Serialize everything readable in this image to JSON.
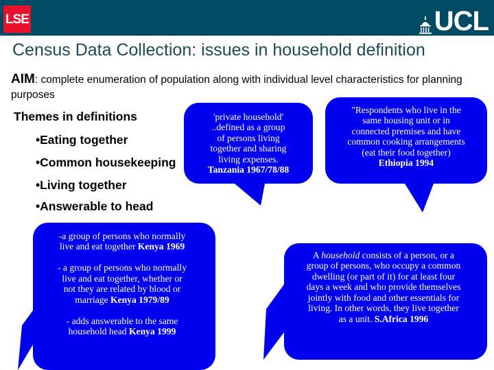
{
  "header": {
    "background_color": "#004a63",
    "lse_logo": {
      "text": "LSE",
      "background_color": "#e8112d"
    },
    "ucl_logo": {
      "text": "UCL",
      "icon": "ucl-dome-icon"
    }
  },
  "slide": {
    "title": "Census Data Collection: issues in household definition",
    "aim": {
      "label": "AIM",
      "body": ": complete enumeration of population along with individual level characteristics for planning purposes"
    },
    "themes": {
      "heading": "Themes in definitions",
      "items": [
        "•Eating together",
        "•Common housekeeping",
        "•Living together",
        "•Answerable to head"
      ]
    }
  },
  "bubbles": {
    "color": "#0000ee",
    "tanzania": {
      "name": "tanzania-definition-callout",
      "body": "'private household'\n..defined as a group\nof persons living\ntogether and sharing\nliving expenses.",
      "source": "Tanzania 1967/78/88"
    },
    "ethiopia": {
      "name": "ethiopia-definition-callout",
      "body": "\"Respondents who live in the\nsame housing unit or in\nconnected premises and have\ncommon cooking arrangements\n(eat their food together)",
      "source": "Ethiopia 1994"
    },
    "kenya": {
      "name": "kenya-definition-callout",
      "line1": "-a group of persons who normally\nlive and eat together ",
      "source1": "Kenya 1969",
      "line2": "- a group of persons who normally\nlive and eat together, whether or\nnot they are related by blood or\nmarriage ",
      "source2": "Kenya 1979/89",
      "line3": "- adds answerable to the same\nhousehold head ",
      "source3": "Kenya 1999"
    },
    "safrica": {
      "name": "south-africa-definition-callout",
      "lead": "A ",
      "emphasis": "household",
      "body": " consists of a person, or a\ngroup of persons, who occupy a common\ndwelling (or part of it) for at least four\ndays a week and who provide themselves\njointly with food and other essentials for\nliving. In other words, they live together\nas a unit.  ",
      "source": "S.Africa 1996"
    }
  }
}
